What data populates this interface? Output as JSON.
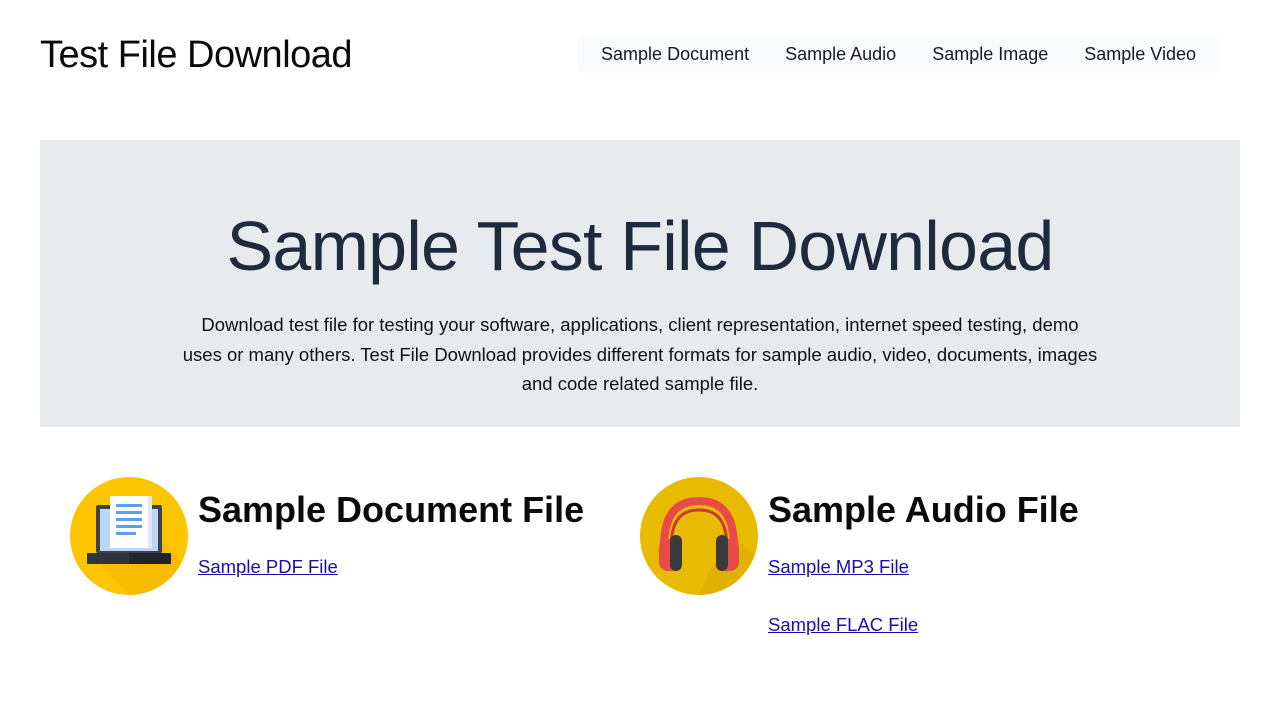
{
  "header": {
    "title": "Test File Download",
    "nav": [
      "Sample Document",
      "Sample Audio",
      "Sample Image",
      "Sample Video"
    ]
  },
  "hero": {
    "heading": "Sample Test File Download",
    "description": "Download test file for testing your software, applications, client representation, internet speed testing, demo uses or many others. Test File Download provides different formats for sample audio, video, documents, images and code related sample file."
  },
  "sections": {
    "document": {
      "icon": "laptop-document-icon",
      "title": "Sample Document File",
      "links": [
        "Sample PDF File"
      ]
    },
    "audio": {
      "icon": "headphones-icon",
      "title": "Sample Audio File",
      "links": [
        "Sample MP3 File",
        "Sample FLAC File"
      ]
    }
  },
  "colors": {
    "hero_bg": "#e8ebee",
    "hero_heading": "#1e2a3d",
    "link": "#1a0dab",
    "icon_yellow": "#fdc500",
    "icon_amber": "#e9bb00",
    "headphone_red": "#e84a4a"
  }
}
